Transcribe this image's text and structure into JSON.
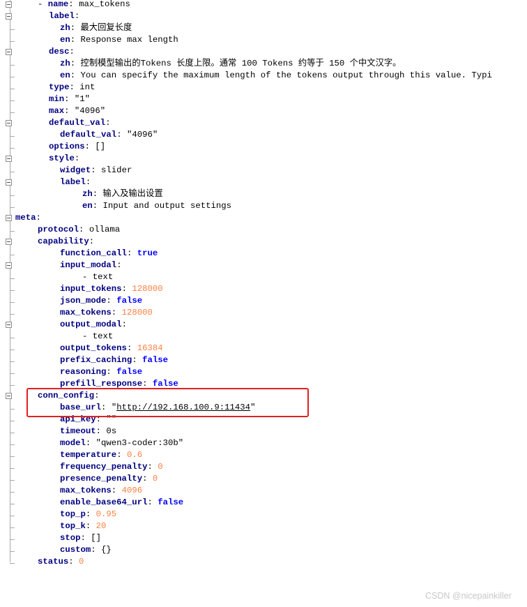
{
  "editor": {
    "lines": [
      {
        "i": 4,
        "fold": true,
        "segs": [
          [
            "- ",
            "p"
          ],
          [
            "name",
            ""
          ],
          [
            ": ",
            "p"
          ],
          [
            "max_tokens",
            "v"
          ]
        ]
      },
      {
        "i": 6,
        "fold": true,
        "segs": [
          [
            "label",
            ""
          ],
          [
            ":",
            "p"
          ]
        ]
      },
      {
        "i": 8,
        "fold": false,
        "segs": [
          [
            "zh",
            ""
          ],
          [
            ": ",
            "p"
          ],
          [
            "最大回复长度",
            "v"
          ]
        ]
      },
      {
        "i": 8,
        "fold": false,
        "segs": [
          [
            "en",
            ""
          ],
          [
            ": ",
            "p"
          ],
          [
            "Response max length",
            "v"
          ]
        ]
      },
      {
        "i": 6,
        "fold": true,
        "segs": [
          [
            "desc",
            ""
          ],
          [
            ":",
            "p"
          ]
        ]
      },
      {
        "i": 8,
        "fold": false,
        "segs": [
          [
            "zh",
            ""
          ],
          [
            ": ",
            "p"
          ],
          [
            "控制模型输出的Tokens 长度上限。通常 100 Tokens 约等于 150 个中文汉字。",
            "v"
          ]
        ]
      },
      {
        "i": 8,
        "fold": false,
        "segs": [
          [
            "en",
            ""
          ],
          [
            ": ",
            "p"
          ],
          [
            "You can specify the maximum length of the tokens output through this value. Typi",
            "v"
          ]
        ]
      },
      {
        "i": 6,
        "fold": false,
        "segs": [
          [
            "type",
            ""
          ],
          [
            ": ",
            "p"
          ],
          [
            "int",
            "v"
          ]
        ]
      },
      {
        "i": 6,
        "fold": false,
        "segs": [
          [
            "min",
            ""
          ],
          [
            ": ",
            "p"
          ],
          [
            "\"1\"",
            "v"
          ]
        ]
      },
      {
        "i": 6,
        "fold": false,
        "segs": [
          [
            "max",
            ""
          ],
          [
            ": ",
            "p"
          ],
          [
            "\"4096\"",
            "v"
          ]
        ]
      },
      {
        "i": 6,
        "fold": true,
        "segs": [
          [
            "default_val",
            ""
          ],
          [
            ":",
            "p"
          ]
        ]
      },
      {
        "i": 8,
        "fold": false,
        "segs": [
          [
            "default_val",
            ""
          ],
          [
            ": ",
            "p"
          ],
          [
            "\"4096\"",
            "v"
          ]
        ]
      },
      {
        "i": 6,
        "fold": false,
        "segs": [
          [
            "options",
            ""
          ],
          [
            ": ",
            "p"
          ],
          [
            "[]",
            "v"
          ]
        ]
      },
      {
        "i": 6,
        "fold": true,
        "segs": [
          [
            "style",
            ""
          ],
          [
            ":",
            "p"
          ]
        ]
      },
      {
        "i": 8,
        "fold": false,
        "segs": [
          [
            "widget",
            ""
          ],
          [
            ": ",
            "p"
          ],
          [
            "slider",
            "v"
          ]
        ]
      },
      {
        "i": 8,
        "fold": true,
        "segs": [
          [
            "label",
            ""
          ],
          [
            ":",
            "p"
          ]
        ]
      },
      {
        "i": 12,
        "fold": false,
        "segs": [
          [
            "zh",
            ""
          ],
          [
            ": ",
            "p"
          ],
          [
            "输入及输出设置",
            "v"
          ]
        ]
      },
      {
        "i": 12,
        "fold": false,
        "segs": [
          [
            "en",
            ""
          ],
          [
            ": ",
            "p"
          ],
          [
            "Input and output settings",
            "v"
          ]
        ]
      },
      {
        "i": 0,
        "fold": true,
        "segs": [
          [
            "meta",
            ""
          ],
          [
            ":",
            "p"
          ]
        ]
      },
      {
        "i": 4,
        "fold": false,
        "segs": [
          [
            "protocol",
            ""
          ],
          [
            ": ",
            "p"
          ],
          [
            "ollama",
            "v"
          ]
        ]
      },
      {
        "i": 4,
        "fold": true,
        "segs": [
          [
            "capability",
            ""
          ],
          [
            ":",
            "p"
          ]
        ]
      },
      {
        "i": 8,
        "fold": false,
        "segs": [
          [
            "function_call",
            ""
          ],
          [
            ": ",
            "p"
          ],
          [
            "true",
            "b"
          ]
        ]
      },
      {
        "i": 8,
        "fold": true,
        "segs": [
          [
            "input_modal",
            ""
          ],
          [
            ":",
            "p"
          ]
        ]
      },
      {
        "i": 12,
        "fold": false,
        "segs": [
          [
            "- ",
            "p"
          ],
          [
            "text",
            "v"
          ]
        ]
      },
      {
        "i": 8,
        "fold": false,
        "segs": [
          [
            "input_tokens",
            ""
          ],
          [
            ": ",
            "p"
          ],
          [
            "128000",
            "n"
          ]
        ]
      },
      {
        "i": 8,
        "fold": false,
        "segs": [
          [
            "json_mode",
            ""
          ],
          [
            ": ",
            "p"
          ],
          [
            "false",
            "b"
          ]
        ]
      },
      {
        "i": 8,
        "fold": false,
        "segs": [
          [
            "max_tokens",
            ""
          ],
          [
            ": ",
            "p"
          ],
          [
            "128000",
            "n"
          ]
        ]
      },
      {
        "i": 8,
        "fold": true,
        "segs": [
          [
            "output_modal",
            ""
          ],
          [
            ":",
            "p"
          ]
        ]
      },
      {
        "i": 12,
        "fold": false,
        "segs": [
          [
            "- ",
            "p"
          ],
          [
            "text",
            "v"
          ]
        ]
      },
      {
        "i": 8,
        "fold": false,
        "segs": [
          [
            "output_tokens",
            ""
          ],
          [
            ": ",
            "p"
          ],
          [
            "16384",
            "n"
          ]
        ]
      },
      {
        "i": 8,
        "fold": false,
        "segs": [
          [
            "prefix_caching",
            ""
          ],
          [
            ": ",
            "p"
          ],
          [
            "false",
            "b"
          ]
        ]
      },
      {
        "i": 8,
        "fold": false,
        "segs": [
          [
            "reasoning",
            ""
          ],
          [
            ": ",
            "p"
          ],
          [
            "false",
            "b"
          ]
        ]
      },
      {
        "i": 8,
        "fold": false,
        "segs": [
          [
            "prefill_response",
            ""
          ],
          [
            ": ",
            "p"
          ],
          [
            "false",
            "b"
          ]
        ]
      },
      {
        "i": 4,
        "fold": true,
        "segs": [
          [
            "conn_config",
            ""
          ],
          [
            ":",
            "p"
          ]
        ]
      },
      {
        "i": 8,
        "fold": false,
        "segs": [
          [
            "base_url",
            ""
          ],
          [
            ": ",
            "p"
          ],
          [
            "\"",
            "v"
          ],
          [
            "http://192.168.100.9:11434",
            "u"
          ],
          [
            "\"",
            "v"
          ]
        ]
      },
      {
        "i": 8,
        "fold": false,
        "segs": [
          [
            "api_key",
            ""
          ],
          [
            ": ",
            "p"
          ],
          [
            "\"\"",
            "v"
          ]
        ]
      },
      {
        "i": 8,
        "fold": false,
        "segs": [
          [
            "timeout",
            ""
          ],
          [
            ": ",
            "p"
          ],
          [
            "0s",
            "v"
          ]
        ]
      },
      {
        "i": 8,
        "fold": false,
        "segs": [
          [
            "model",
            ""
          ],
          [
            ": ",
            "p"
          ],
          [
            "\"qwen3-coder:30b\"",
            "v"
          ]
        ]
      },
      {
        "i": 8,
        "fold": false,
        "segs": [
          [
            "temperature",
            ""
          ],
          [
            ": ",
            "p"
          ],
          [
            "0.6",
            "n"
          ]
        ]
      },
      {
        "i": 8,
        "fold": false,
        "segs": [
          [
            "frequency_penalty",
            ""
          ],
          [
            ": ",
            "p"
          ],
          [
            "0",
            "n"
          ]
        ]
      },
      {
        "i": 8,
        "fold": false,
        "segs": [
          [
            "presence_penalty",
            ""
          ],
          [
            ": ",
            "p"
          ],
          [
            "0",
            "n"
          ]
        ]
      },
      {
        "i": 8,
        "fold": false,
        "segs": [
          [
            "max_tokens",
            ""
          ],
          [
            ": ",
            "p"
          ],
          [
            "4096",
            "n"
          ]
        ]
      },
      {
        "i": 8,
        "fold": false,
        "segs": [
          [
            "enable_base64_url",
            ""
          ],
          [
            ": ",
            "p"
          ],
          [
            "false",
            "b"
          ]
        ]
      },
      {
        "i": 8,
        "fold": false,
        "segs": [
          [
            "top_p",
            ""
          ],
          [
            ": ",
            "p"
          ],
          [
            "0.95",
            "n"
          ]
        ]
      },
      {
        "i": 8,
        "fold": false,
        "segs": [
          [
            "top_k",
            ""
          ],
          [
            ": ",
            "p"
          ],
          [
            "20",
            "n"
          ]
        ]
      },
      {
        "i": 8,
        "fold": false,
        "segs": [
          [
            "stop",
            ""
          ],
          [
            ": ",
            "p"
          ],
          [
            "[]",
            "v"
          ]
        ]
      },
      {
        "i": 8,
        "fold": false,
        "segs": [
          [
            "custom",
            ""
          ],
          [
            ": ",
            "p"
          ],
          [
            "{}",
            "v"
          ]
        ]
      },
      {
        "i": 4,
        "fold": false,
        "segs": [
          [
            "status",
            ""
          ],
          [
            ": ",
            "p"
          ],
          [
            "0",
            "n"
          ]
        ]
      }
    ],
    "highlight_color": "#e02020",
    "key_color": "#000080",
    "number_color": "#ff8040",
    "boolean_color": "#0000ff"
  },
  "watermark": {
    "text": "CSDN @nicepainkiller"
  }
}
